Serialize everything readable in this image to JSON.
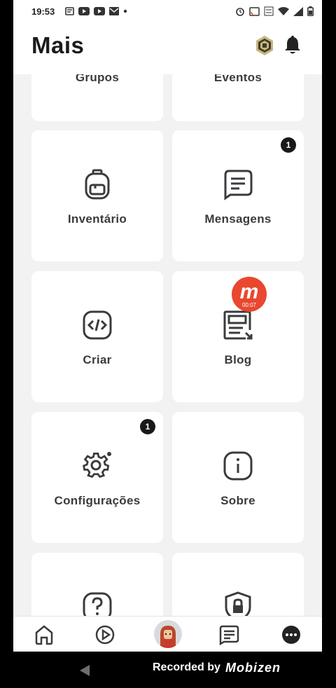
{
  "status": {
    "time": "19:53"
  },
  "header": {
    "title": "Mais"
  },
  "tiles": [
    {
      "label": "Grupos"
    },
    {
      "label": "Eventos"
    },
    {
      "label": "Inventário"
    },
    {
      "label": "Mensagens",
      "badge": "1"
    },
    {
      "label": "Criar"
    },
    {
      "label": "Blog"
    },
    {
      "label": "Configurações",
      "badge": "1"
    },
    {
      "label": "Sobre"
    }
  ],
  "overlay": {
    "bubble_letter": "m",
    "bubble_timer": "00:07"
  },
  "recorder": {
    "text": "Recorded by",
    "brand": "Mobizen"
  },
  "colors": {
    "badge": "#191919",
    "bubble": "#e9472f",
    "icon_stroke": "#393b3d"
  }
}
